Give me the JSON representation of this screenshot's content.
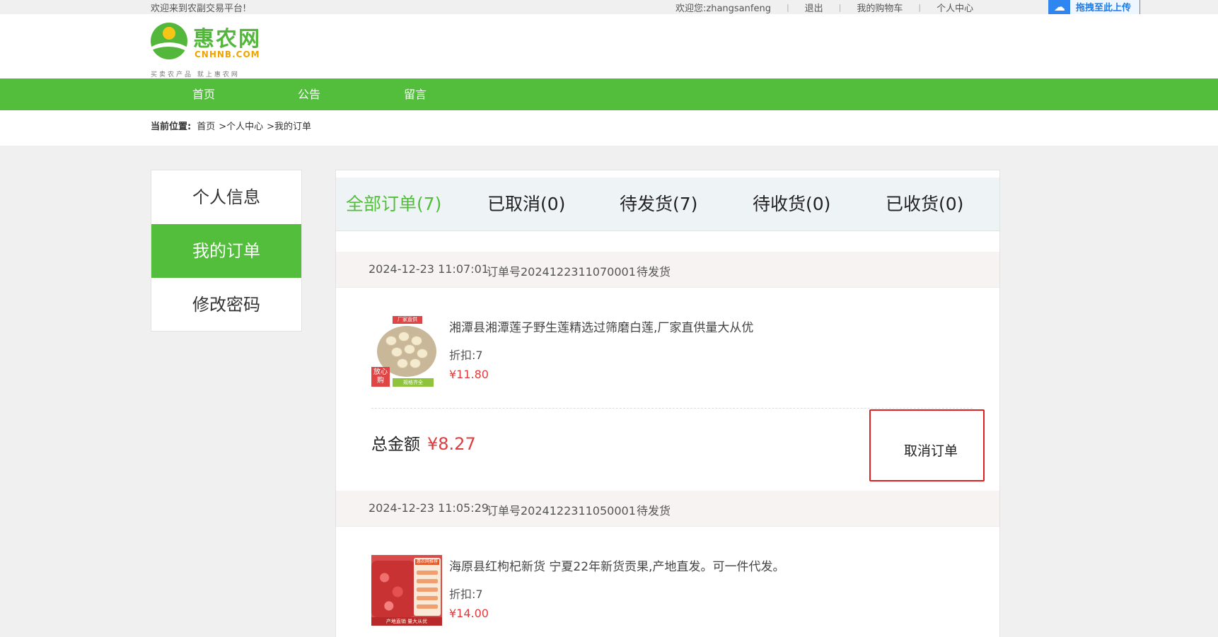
{
  "topbar": {
    "welcome": "欢迎来到农副交易平台!",
    "greeting": "欢迎您:zhangsanfeng",
    "logout": "退出",
    "cart": "我的购物车",
    "profile": "个人中心",
    "upload": "拖拽至此上传"
  },
  "logo": {
    "brand": "惠农网",
    "domain": "CNHNB.COM",
    "slogan": "买卖农产品  就上惠农网"
  },
  "nav": [
    "首页",
    "公告",
    "留言"
  ],
  "breadcrumb": {
    "label": "当前位置:",
    "items": [
      "首页",
      ">个人中心",
      ">我的订单"
    ]
  },
  "sidebar": {
    "items": [
      {
        "label": "个人信息",
        "active": false
      },
      {
        "label": "我的订单",
        "active": true
      },
      {
        "label": "修改密码",
        "active": false
      }
    ]
  },
  "tabs": [
    {
      "label": "全部订单(7)",
      "active": true
    },
    {
      "label": "已取消(0)",
      "active": false
    },
    {
      "label": "待发货(7)",
      "active": false
    },
    {
      "label": "待收货(0)",
      "active": false
    },
    {
      "label": "已收货(0)",
      "active": false
    }
  ],
  "orders": [
    {
      "time": "2024-12-23 11:07:01",
      "order_no": "订单号2024122311070001",
      "status": "待发货",
      "product": {
        "title": "湘潭县湘潭莲子野生莲精选过筛磨白莲,厂家直供量大从优",
        "discount": "折扣:7",
        "price": "¥11.80",
        "image_tag": "厂家直供",
        "image_badge": "放心购",
        "image_bottom": "规格齐全"
      },
      "total_label": "总金额",
      "total": "¥8.27",
      "cancel_label": "取消订单"
    },
    {
      "time": "2024-12-23 11:05:29",
      "order_no": "订单号2024122311050001",
      "status": "待发货",
      "product": {
        "title": "海原县红枸杞新货 宁夏22年新货贡果,产地直发。可一件代发。",
        "discount": "折扣:7",
        "price": "¥14.00",
        "image_tag": "惠农网推荐",
        "image_bottom": "产地直销 量大从优"
      }
    }
  ],
  "colors": {
    "green": "#52be3c",
    "red": "#e03c3c",
    "highlight_border": "#e02020"
  }
}
